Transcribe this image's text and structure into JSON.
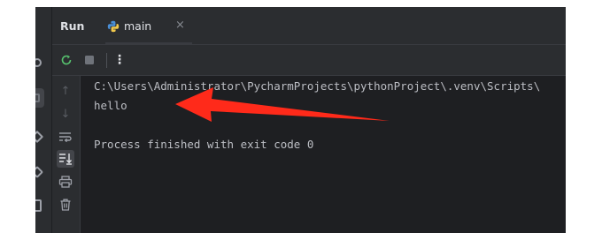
{
  "tool_window": {
    "title": "Run",
    "tab": {
      "label": "main",
      "icon": "python-file-icon",
      "close_glyph": "×"
    }
  },
  "toolbar": {
    "buttons": [
      {
        "name": "rerun-icon"
      },
      {
        "name": "stop-icon"
      },
      {
        "name": "more-options-icon",
        "glyph": "⋮"
      }
    ]
  },
  "gutter": {
    "buttons": [
      {
        "name": "arrow-up-icon",
        "glyph": "↑"
      },
      {
        "name": "arrow-down-icon",
        "glyph": "↓"
      },
      {
        "name": "soft-wrap-icon"
      },
      {
        "name": "scroll-to-end-icon"
      },
      {
        "name": "print-icon"
      },
      {
        "name": "trash-icon"
      }
    ]
  },
  "console": {
    "lines": [
      "C:\\Users\\Administrator\\PycharmProjects\\pythonProject\\.venv\\Scripts\\",
      "hello",
      "",
      "Process finished with exit code 0"
    ]
  },
  "colors": {
    "panel_bg": "#2b2d30",
    "console_bg": "#1e1f22",
    "text": "#bcbec4",
    "annotation": "#ff2a1a"
  }
}
